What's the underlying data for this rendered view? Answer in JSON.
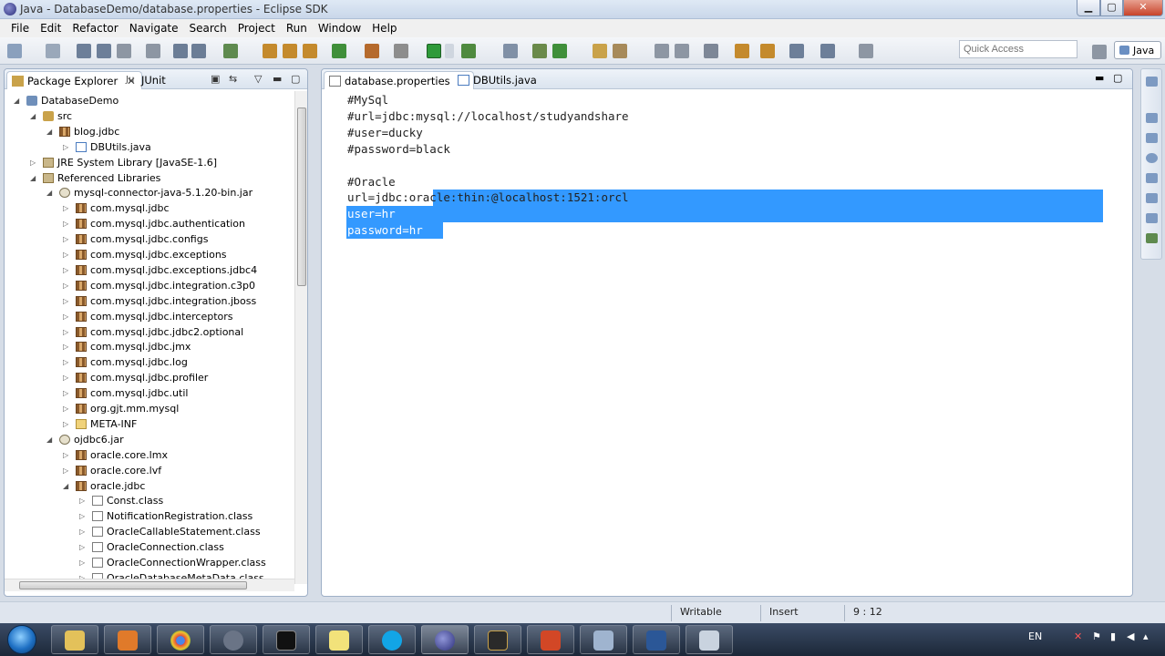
{
  "window": {
    "title": "Java - DatabaseDemo/database.properties - Eclipse SDK"
  },
  "menu": [
    "File",
    "Edit",
    "Refactor",
    "Navigate",
    "Search",
    "Project",
    "Run",
    "Window",
    "Help"
  ],
  "toolbar": {
    "quick_access_placeholder": "Quick Access",
    "perspective_label": "Java"
  },
  "left_panel": {
    "tabs": [
      {
        "label": "Package Explorer",
        "close": "✕",
        "icon": "package-explorer-icon"
      },
      {
        "label": "JUnit",
        "icon": "junit-icon"
      }
    ],
    "tree": [
      {
        "label": "DatabaseDemo",
        "indent": 0,
        "expanded": true,
        "icon": "project"
      },
      {
        "label": "src",
        "indent": 1,
        "expanded": true,
        "icon": "src"
      },
      {
        "label": "blog.jdbc",
        "indent": 2,
        "expanded": true,
        "icon": "pkg"
      },
      {
        "label": "DBUtils.java",
        "indent": 3,
        "expanded": false,
        "icon": "java"
      },
      {
        "label": "JRE System Library [JavaSE-1.6]",
        "indent": 1,
        "expanded": false,
        "icon": "lib"
      },
      {
        "label": "Referenced Libraries",
        "indent": 1,
        "expanded": true,
        "icon": "lib"
      },
      {
        "label": "mysql-connector-java-5.1.20-bin.jar",
        "indent": 2,
        "expanded": true,
        "icon": "jar"
      },
      {
        "label": "com.mysql.jdbc",
        "indent": 3,
        "expanded": false,
        "icon": "pkg"
      },
      {
        "label": "com.mysql.jdbc.authentication",
        "indent": 3,
        "expanded": false,
        "icon": "pkg"
      },
      {
        "label": "com.mysql.jdbc.configs",
        "indent": 3,
        "expanded": false,
        "icon": "pkg"
      },
      {
        "label": "com.mysql.jdbc.exceptions",
        "indent": 3,
        "expanded": false,
        "icon": "pkg"
      },
      {
        "label": "com.mysql.jdbc.exceptions.jdbc4",
        "indent": 3,
        "expanded": false,
        "icon": "pkg"
      },
      {
        "label": "com.mysql.jdbc.integration.c3p0",
        "indent": 3,
        "expanded": false,
        "icon": "pkg"
      },
      {
        "label": "com.mysql.jdbc.integration.jboss",
        "indent": 3,
        "expanded": false,
        "icon": "pkg"
      },
      {
        "label": "com.mysql.jdbc.interceptors",
        "indent": 3,
        "expanded": false,
        "icon": "pkg"
      },
      {
        "label": "com.mysql.jdbc.jdbc2.optional",
        "indent": 3,
        "expanded": false,
        "icon": "pkg"
      },
      {
        "label": "com.mysql.jdbc.jmx",
        "indent": 3,
        "expanded": false,
        "icon": "pkg"
      },
      {
        "label": "com.mysql.jdbc.log",
        "indent": 3,
        "expanded": false,
        "icon": "pkg"
      },
      {
        "label": "com.mysql.jdbc.profiler",
        "indent": 3,
        "expanded": false,
        "icon": "pkg"
      },
      {
        "label": "com.mysql.jdbc.util",
        "indent": 3,
        "expanded": false,
        "icon": "pkg"
      },
      {
        "label": "org.gjt.mm.mysql",
        "indent": 3,
        "expanded": false,
        "icon": "pkg"
      },
      {
        "label": "META-INF",
        "indent": 3,
        "expanded": false,
        "icon": "folder"
      },
      {
        "label": "ojdbc6.jar",
        "indent": 2,
        "expanded": true,
        "icon": "jar"
      },
      {
        "label": "oracle.core.lmx",
        "indent": 3,
        "expanded": false,
        "icon": "pkg"
      },
      {
        "label": "oracle.core.lvf",
        "indent": 3,
        "expanded": false,
        "icon": "pkg"
      },
      {
        "label": "oracle.jdbc",
        "indent": 3,
        "expanded": true,
        "icon": "pkg"
      },
      {
        "label": "Const.class",
        "indent": 4,
        "expanded": false,
        "icon": "class"
      },
      {
        "label": "NotificationRegistration.class",
        "indent": 4,
        "expanded": false,
        "icon": "class"
      },
      {
        "label": "OracleCallableStatement.class",
        "indent": 4,
        "expanded": false,
        "icon": "class"
      },
      {
        "label": "OracleConnection.class",
        "indent": 4,
        "expanded": false,
        "icon": "class"
      },
      {
        "label": "OracleConnectionWrapper.class",
        "indent": 4,
        "expanded": false,
        "icon": "class"
      },
      {
        "label": "OracleDatabaseMetaData.class",
        "indent": 4,
        "expanded": false,
        "icon": "class"
      }
    ]
  },
  "editor": {
    "tabs": [
      {
        "label": "database.properties",
        "close": "✕",
        "active": true
      },
      {
        "label": "DBUtils.java",
        "active": false
      }
    ],
    "lines": [
      "#MySql",
      "#url=jdbc:mysql://localhost/studyandshare",
      "#user=ducky",
      "#password=black",
      "",
      "#Oracle",
      "url=jdbc:oracle:thin:@localhost:1521:orcl",
      "user=hr",
      "password=hr"
    ],
    "selection_start_line": 7,
    "selection_end_line": 9
  },
  "status": {
    "writable": "Writable",
    "insert_mode": "Insert",
    "position": "9 : 12"
  },
  "taskbar": {
    "language": "EN",
    "apps": [
      "explorer",
      "media-player",
      "chrome",
      "fl-studio",
      "terminal",
      "sticky-notes",
      "skype",
      "eclipse",
      "game",
      "powerpoint",
      "ie-like",
      "word",
      "note"
    ]
  }
}
